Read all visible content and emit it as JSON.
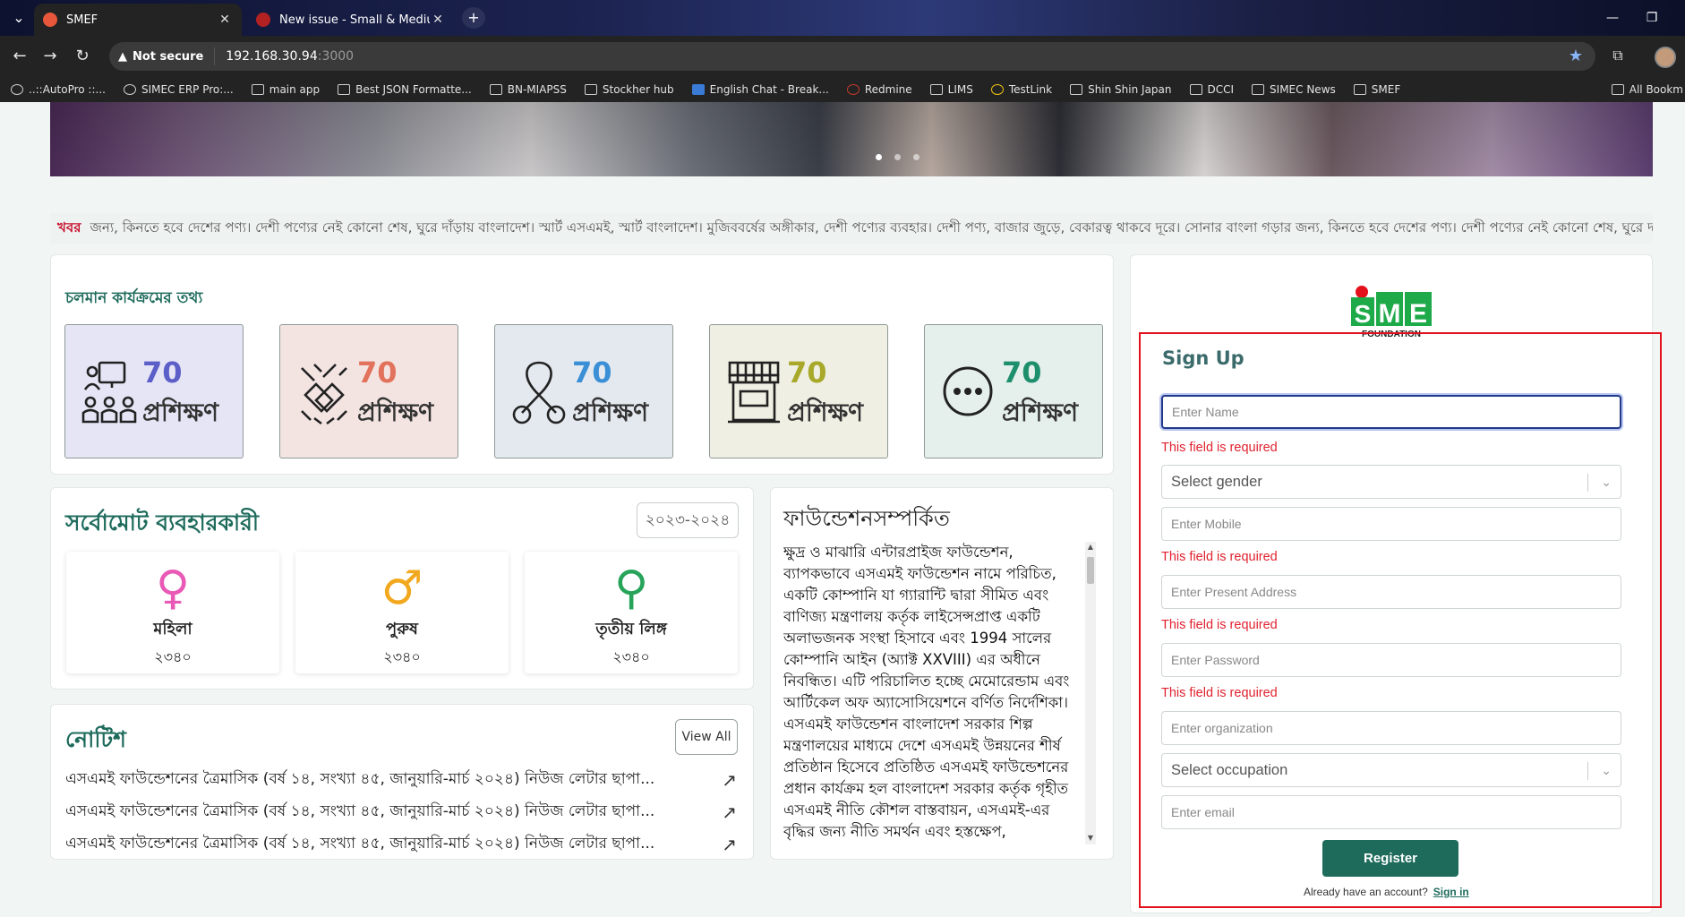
{
  "browser": {
    "tabs": [
      {
        "title": "SMEF",
        "active": true,
        "favicon_color": "#e8573b"
      },
      {
        "title": "New issue - Small & Medium E",
        "active": false,
        "favicon_color": "#b22222"
      }
    ],
    "new_tab_icon": "plus-icon",
    "security_label": "Not secure",
    "url_host": "192.168.30.94",
    "url_port": ":3000",
    "bookmarks": [
      {
        "label": "..::AutoPro ::...",
        "icon": "globe-icon"
      },
      {
        "label": "SIMEC ERP Pro:...",
        "icon": "globe-icon"
      },
      {
        "label": "main app",
        "icon": "page-icon"
      },
      {
        "label": "Best JSON Formatte...",
        "icon": "page-icon"
      },
      {
        "label": "BN-MIAPSS",
        "icon": "folder-icon"
      },
      {
        "label": "Stockher hub",
        "icon": "folder-icon"
      },
      {
        "label": "English Chat - Break...",
        "icon": "page-icon"
      },
      {
        "label": "Redmine",
        "icon": "page-icon"
      },
      {
        "label": "LIMS",
        "icon": "folder-icon"
      },
      {
        "label": "TestLink",
        "icon": "page-icon"
      },
      {
        "label": "Shin Shin Japan",
        "icon": "folder-icon"
      },
      {
        "label": "DCCI",
        "icon": "folder-icon"
      },
      {
        "label": "SIMEC News",
        "icon": "folder-icon"
      },
      {
        "label": "SMEF",
        "icon": "folder-icon"
      }
    ],
    "all_bookmarks": "All Bookm"
  },
  "ticker": {
    "label": "খবর",
    "text": "জন্য, কিনতে হবে দেশের পণ্য। দেশী পণ্যের নেই কোনো শেষ, ঘুরে দাঁড়ায় বাংলাদেশ। স্মার্ট এসএমই, স্মার্ট বাংলাদেশ। মুজিববর্ষের অঙ্গীকার, দেশী পণ্যের ব্যবহার। দেশী পণ্য, বাজার জুড়ে, বেকারত্ব থাকবে দূরে। সোনার বাংলা গড়ার জন্য, কিনতে হবে দেশের পণ্য। দেশী পণ্যের নেই কোনো শেষ, ঘুরে দাঁ"
  },
  "programs": {
    "title": "চলমান কার্যক্রমের তথ্য",
    "items": [
      {
        "value": "70",
        "label": "প্রশিক্ষণ",
        "icon": "training-icon",
        "bg": "#e6e5f5",
        "color": "#5b5fc7"
      },
      {
        "value": "70",
        "label": "প্রশিক্ষণ",
        "icon": "handshake-icon",
        "bg": "#f3e4e2",
        "color": "#e2725b"
      },
      {
        "value": "70",
        "label": "প্রশিক্ষণ",
        "icon": "ribbon-icon",
        "bg": "#e4e9ef",
        "color": "#3a8fd6"
      },
      {
        "value": "70",
        "label": "প্রশিক্ষণ",
        "icon": "shop-icon",
        "bg": "#efefe3",
        "color": "#a8a82a"
      },
      {
        "value": "70",
        "label": "প্রশিক্ষণ",
        "icon": "more-icon",
        "bg": "#e5efec",
        "color": "#1d8f6c"
      }
    ]
  },
  "users": {
    "title": "সর্বোমোট ব্যবহারকারী",
    "year": "২০২৩-২০২৪",
    "items": [
      {
        "label": "মহিলা",
        "value": "২৩৪০",
        "icon": "female-icon",
        "glyph": "♀",
        "color": "#e85ab5"
      },
      {
        "label": "পুরুষ",
        "value": "২৩৪০",
        "icon": "male-icon",
        "glyph": "♂",
        "color": "#f2a81e"
      },
      {
        "label": "তৃতীয় লিঙ্গ",
        "value": "২৩৪০",
        "icon": "third-gender-icon",
        "glyph": "⚲",
        "color": "#27a45a"
      }
    ]
  },
  "notice": {
    "title": "নোটিশ",
    "view_all": "View All",
    "items": [
      "এসএমই ফাউন্ডেশনের ত্রৈমাসিক (বর্ষ ১৪, সংখ্যা ৪৫, জানুয়ারি-মার্চ ২০২৪) নিউজ লেটার ছাপা...",
      "এসএমই ফাউন্ডেশনের ত্রৈমাসিক (বর্ষ ১৪, সংখ্যা ৪৫, জানুয়ারি-মার্চ ২০২৪) নিউজ লেটার ছাপা...",
      "এসএমই ফাউন্ডেশনের ত্রৈমাসিক (বর্ষ ১৪, সংখ্যা ৪৫, জানুয়ারি-মার্চ ২০২৪) নিউজ লেটার ছাপা..."
    ]
  },
  "about": {
    "title": "ফাউন্ডেশনসম্পর্কিত",
    "text": "ক্ষুদ্র ও মাঝারি এন্টারপ্রাইজ ফাউন্ডেশন, ব্যাপকভাবে এসএমই ফাউন্ডেশন নামে পরিচিত, একটি কোম্পানি যা গ্যারান্টি দ্বারা সীমিত এবং বাণিজ্য মন্ত্রণালয় কর্তৃক লাইসেন্সপ্রাপ্ত একটি অলাভজনক সংস্থা হিসাবে এবং 1994 সালের কোম্পানি আইন (অ্যাক্ট XXVIII) এর অধীনে নিবন্ধিত। এটি পরিচালিত হচ্ছে মেমোরেন্ডাম এবং আর্টিকেল অফ অ্যাসোসিয়েশনে বর্ণিত নির্দেশিকা। এসএমই ফাউন্ডেশন বাংলাদেশ সরকার শিল্প মন্ত্রণালয়ের মাধ্যমে দেশে এসএমই উন্নয়নের শীর্ষ প্রতিষ্ঠান হিসেবে প্রতিষ্ঠিত এসএমই ফাউন্ডেশনের প্রধান কার্যক্রম হল বাংলাদেশ সরকার কর্তৃক গৃহীত এসএমই নীতি কৌশল বাস্তবায়ন, এসএমই-এর বৃদ্ধির জন্য নীতি সমর্থন এবং হস্তক্ষেপ,"
  },
  "signup": {
    "logo_text": "SME",
    "logo_sub": "FOUNDATION",
    "title": "Sign Up",
    "name_placeholder": "Enter Name",
    "gender_placeholder": "Select gender",
    "mobile_placeholder": "Enter Mobile",
    "address_placeholder": "Enter Present Address",
    "password_placeholder": "Enter Password",
    "organization_placeholder": "Enter organization",
    "occupation_placeholder": "Select occupation",
    "email_placeholder": "Enter email",
    "required_msg": "This field is required",
    "register_label": "Register",
    "already_text": "Already have an account?",
    "signin_label": "Sign in"
  }
}
